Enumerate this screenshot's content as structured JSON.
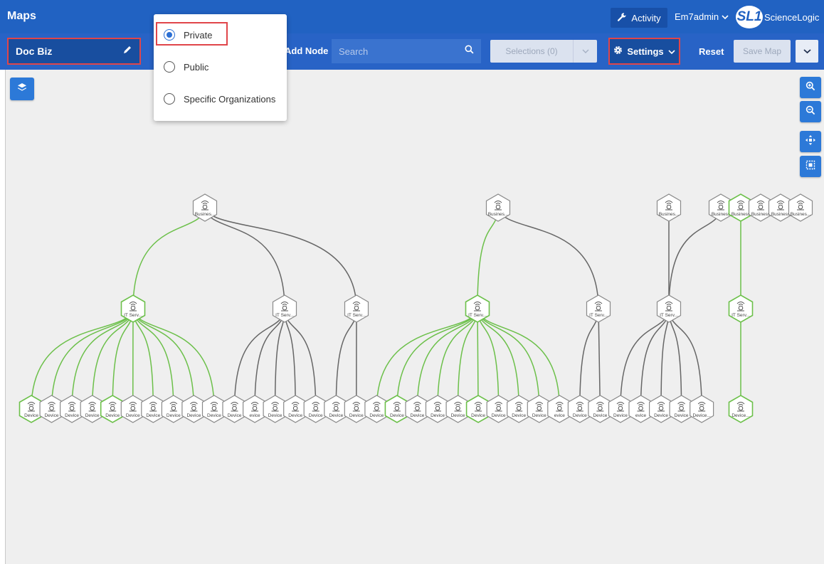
{
  "header": {
    "title": "Maps",
    "activity_label": "Activity",
    "user_label": "Em7admin",
    "brand_mark": "SL1",
    "brand_name": "ScienceLogic"
  },
  "toolbar": {
    "map_name": "Doc Biz",
    "add_node_label": "Add Node",
    "search_placeholder": "Search",
    "selections_label": "Selections (0)",
    "settings_label": "Settings",
    "reset_label": "Reset",
    "save_map_label": "Save Map"
  },
  "visibility_menu": {
    "options": [
      {
        "label": "Private",
        "selected": true
      },
      {
        "label": "Public",
        "selected": false
      },
      {
        "label": "Specific Organizations",
        "selected": false
      }
    ]
  },
  "map_labels": {
    "business": "Busines...",
    "business_short": "Business",
    "it_service": "IT Serv...",
    "device": "Device",
    "device_short": "evice",
    "device_trunc": "Device..."
  },
  "colors": {
    "header_blue": "#2162c2",
    "toolbar_blue": "#2863c6",
    "highlight_red": "#e0454a",
    "edge_green": "#6cc04a",
    "edge_gray": "#666666"
  },
  "icons": [
    "wrench-icon",
    "chevron-down-icon",
    "pencil-icon",
    "search-icon",
    "gear-icon",
    "layers-icon",
    "zoom-in-icon",
    "zoom-out-icon",
    "pan-icon",
    "fit-screen-icon",
    "device-icon"
  ]
}
